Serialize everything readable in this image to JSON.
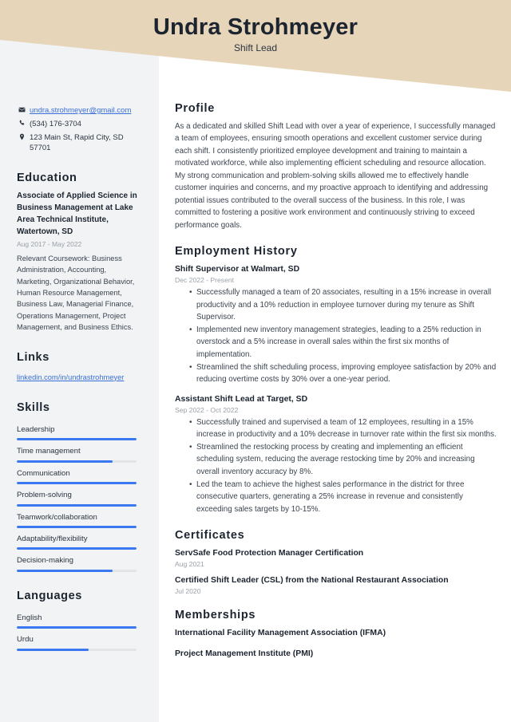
{
  "theme": {
    "banner_color": "#e6d5b8",
    "sidebar_color": "#f1f3f5",
    "accent_color": "#3b77f0",
    "link_color": "#3a6fd8",
    "heading_color": "#1c2430",
    "muted_color": "#9aa1a9"
  },
  "header": {
    "full_name": "Undra Strohmeyer",
    "job_title": "Shift Lead"
  },
  "sidebar": {
    "contact": {
      "email": "undra.strohmeyer@gmail.com",
      "phone": "(534) 176-3704",
      "address": "123 Main St, Rapid City, SD 57701",
      "email_icon": "envelope-icon",
      "phone_icon": "phone-icon",
      "address_icon": "map-pin-icon"
    },
    "education": {
      "heading": "Education",
      "entries": [
        {
          "title": "Associate of Applied Science in Business Management at Lake Area Technical Institute, Watertown, SD",
          "date": "Aug 2017 - May 2022",
          "description": "Relevant Coursework: Business Administration, Accounting, Marketing, Organizational Behavior, Human Resource Management, Business Law, Managerial Finance, Operations Management, Project Management, and Business Ethics."
        }
      ]
    },
    "links": {
      "heading": "Links",
      "items": [
        {
          "label": "linkedin.com/in/undrastrohmeyer"
        }
      ]
    },
    "skills": {
      "heading": "Skills",
      "items": [
        {
          "label": "Leadership",
          "level": 100
        },
        {
          "label": "Time management",
          "level": 80
        },
        {
          "label": "Communication",
          "level": 100
        },
        {
          "label": "Problem-solving",
          "level": 100
        },
        {
          "label": "Teamwork/collaboration",
          "level": 100
        },
        {
          "label": "Adaptability/flexibility",
          "level": 100
        },
        {
          "label": "Decision-making",
          "level": 80
        }
      ]
    },
    "languages": {
      "heading": "Languages",
      "items": [
        {
          "label": "English",
          "level": 100
        },
        {
          "label": "Urdu",
          "level": 60
        }
      ]
    }
  },
  "main": {
    "profile": {
      "heading": "Profile",
      "text": "As a dedicated and skilled Shift Lead with over a year of experience, I successfully managed a team of employees, ensuring smooth operations and excellent customer service during each shift. I consistently prioritized employee development and training to maintain a motivated workforce, while also implementing efficient scheduling and resource allocation. My strong communication and problem-solving skills allowed me to effectively handle customer inquiries and concerns, and my proactive approach to identifying and addressing potential issues contributed to the overall success of the business. In this role, I was committed to fostering a positive work environment and continuously striving to exceed performance goals."
    },
    "employment": {
      "heading": "Employment History",
      "jobs": [
        {
          "title": "Shift Supervisor at Walmart, SD",
          "date": "Dec 2022 - Present",
          "bullets": [
            "Successfully managed a team of 20 associates, resulting in a 15% increase in overall productivity and a 10% reduction in employee turnover during my tenure as Shift Supervisor.",
            "Implemented new inventory management strategies, leading to a 25% reduction in overstock and a 5% increase in overall sales within the first six months of implementation.",
            "Streamlined the shift scheduling process, improving employee satisfaction by 20% and reducing overtime costs by 30% over a one-year period."
          ]
        },
        {
          "title": "Assistant Shift Lead at Target, SD",
          "date": "Sep 2022 - Oct 2022",
          "bullets": [
            "Successfully trained and supervised a team of 12 employees, resulting in a 15% increase in productivity and a 10% decrease in turnover rate within the first six months.",
            "Streamlined the restocking process by creating and implementing an efficient scheduling system, reducing the average restocking time by 20% and increasing overall inventory accuracy by 8%.",
            "Led the team to achieve the highest sales performance in the district for three consecutive quarters, generating a 25% increase in revenue and consistently exceeding sales targets by 10-15%."
          ]
        }
      ]
    },
    "certificates": {
      "heading": "Certificates",
      "items": [
        {
          "title": "ServSafe Food Protection Manager Certification",
          "date": "Aug 2021"
        },
        {
          "title": "Certified Shift Leader (CSL) from the National Restaurant Association",
          "date": "Jul 2020"
        }
      ]
    },
    "memberships": {
      "heading": "Memberships",
      "items": [
        {
          "title": "International Facility Management Association (IFMA)"
        },
        {
          "title": "Project Management Institute (PMI)"
        }
      ]
    }
  }
}
